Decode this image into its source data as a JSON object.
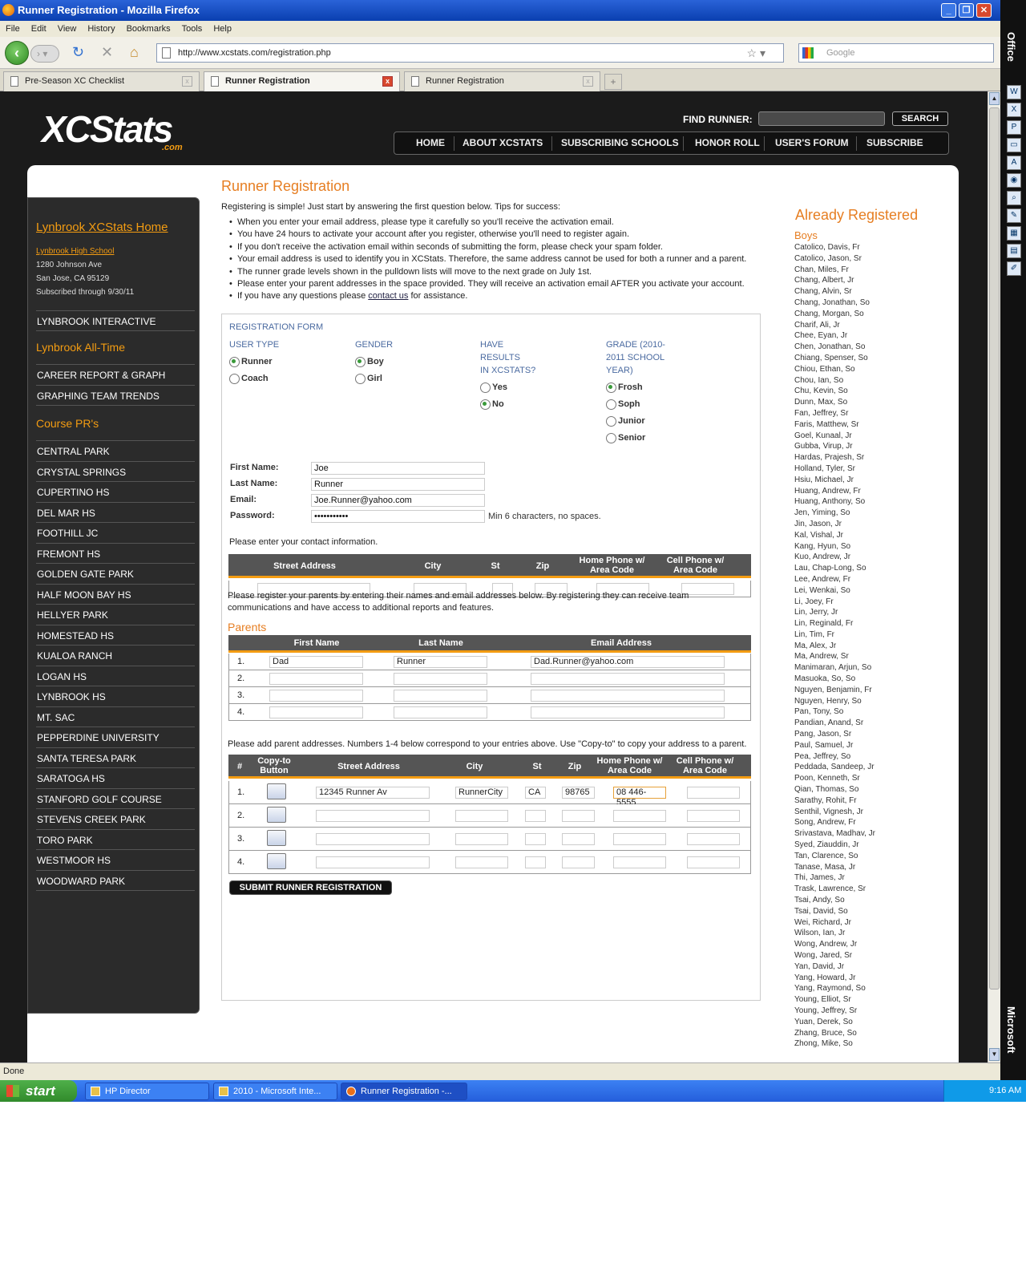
{
  "window": {
    "title": "Runner Registration - Mozilla Firefox"
  },
  "menu": [
    "File",
    "Edit",
    "View",
    "History",
    "Bookmarks",
    "Tools",
    "Help"
  ],
  "url": "http://www.xcstats.com/registration.php",
  "search_placeholder": "Google",
  "tabs": [
    {
      "label": "Pre-Season XC Checklist"
    },
    {
      "label": "Runner Registration"
    },
    {
      "label": "Runner Registration"
    }
  ],
  "status": "Done",
  "taskbar": {
    "start": "start",
    "items": [
      "HP Director",
      "2010 - Microsoft Inte...",
      "Runner Registration -..."
    ],
    "clock": "9:16 AM"
  },
  "officebar": {
    "top": "Office",
    "bottom": "Microsoft"
  },
  "site": {
    "logo": "XCStats",
    "logo_sub": ".com",
    "find_label": "FIND RUNNER:",
    "search_btn": "SEARCH",
    "nav": [
      "HOME",
      "ABOUT XCSTATS",
      "SUBSCRIBING SCHOOLS",
      "HONOR ROLL",
      "USER'S FORUM",
      "SUBSCRIBE"
    ]
  },
  "sidebar": {
    "home": "Lynbrook XCStats Home",
    "school": "Lynbrook High School",
    "addr1": "1280 Johnson Ave",
    "addr2": "San Jose, CA 95129",
    "sub": "Subscribed through 9/30/11",
    "interactive": "LYNBROOK INTERACTIVE",
    "alltime": "Lynbrook All-Time",
    "alltime_items": [
      "CAREER REPORT & GRAPH",
      "GRAPHING TEAM TRENDS"
    ],
    "course_head": "Course PR's",
    "courses": [
      "CENTRAL PARK",
      "CRYSTAL SPRINGS",
      "CUPERTINO HS",
      "DEL MAR HS",
      "FOOTHILL JC",
      "FREMONT HS",
      "GOLDEN GATE PARK",
      "HALF MOON BAY HS",
      "HELLYER PARK",
      "HOMESTEAD HS",
      "KUALOA RANCH",
      "LOGAN HS",
      "LYNBROOK HS",
      "MT. SAC",
      "PEPPERDINE UNIVERSITY",
      "SANTA TERESA PARK",
      "SARATOGA HS",
      "STANFORD GOLF COURSE",
      "STEVENS CREEK PARK",
      "TORO PARK",
      "WESTMOOR HS",
      "WOODWARD PARK"
    ]
  },
  "page": {
    "title": "Runner Registration",
    "intro": "Registering is simple! Just start by answering the first question below. Tips for success:",
    "tips_pre": [
      "When you enter your email address, please type it carefully so you'll receive the activation email.",
      "You have 24 hours to activate your account after you register, otherwise you'll need to register again.",
      "If you don't receive the activation email within seconds of submitting the form, please check your spam folder.",
      "Your email address is used to identify you in XCStats. Therefore, the same address cannot be used for both a runner and a parent.",
      "The runner grade levels shown in the pulldown lists will move to the next grade on July 1st.",
      "Please enter your parent addresses in the space provided. They will receive an activation email AFTER you activate your account."
    ],
    "tip_last_a": "If you have any questions please ",
    "tip_last_link": "contact us",
    "tip_last_b": " for assistance."
  },
  "form": {
    "heading": "REGISTRATION FORM",
    "user_type": {
      "label": "USER TYPE",
      "options": [
        "Runner",
        "Coach"
      ],
      "selected": "Runner"
    },
    "gender": {
      "label": "GENDER",
      "options": [
        "Boy",
        "Girl"
      ],
      "selected": "Boy"
    },
    "results": {
      "label1": "HAVE",
      "label2": "RESULTS",
      "label3": "IN XCSTATS?",
      "options": [
        "Yes",
        "No"
      ],
      "selected": "No"
    },
    "grade": {
      "label1": "GRADE (2010-",
      "label2": "2011 SCHOOL",
      "label3": "YEAR)",
      "options": [
        "Frosh",
        "Soph",
        "Junior",
        "Senior"
      ],
      "selected": "Frosh"
    },
    "first_name_label": "First Name:",
    "first_name": "Joe",
    "last_name_label": "Last Name:",
    "last_name": "Runner",
    "email_label": "Email:",
    "email": "Joe.Runner@yahoo.com",
    "password_label": "Password:",
    "password": "•••••••••••",
    "password_hint": "Min 6 characters, no spaces.",
    "contact_hint": "Please enter your contact information.",
    "contact_headers": [
      "Street Address",
      "City",
      "St",
      "Zip",
      "Home Phone w/ Area Code",
      "Cell Phone w/ Area Code"
    ],
    "parent_hint": "Please register your parents by entering their names and email addresses below. By registering they can receive team communications and have access to additional reports and features.",
    "parents_heading": "Parents",
    "parent_headers": [
      "First Name",
      "Last Name",
      "Email Address"
    ],
    "parents": [
      {
        "num": "1.",
        "first": "Dad",
        "last": "Runner",
        "email": "Dad.Runner@yahoo.com"
      },
      {
        "num": "2.",
        "first": "",
        "last": "",
        "email": ""
      },
      {
        "num": "3.",
        "first": "",
        "last": "",
        "email": ""
      },
      {
        "num": "4.",
        "first": "",
        "last": "",
        "email": ""
      }
    ],
    "addr_hint": "Please add parent addresses. Numbers 1-4 below correspond to your entries above. Use \"Copy-to\" to copy your address to a parent.",
    "addr_headers": [
      "#",
      "Copy-to Button",
      "Street Address",
      "City",
      "St",
      "Zip",
      "Home Phone w/ Area Code",
      "Cell Phone w/ Area Code"
    ],
    "addresses": [
      {
        "num": "1.",
        "street": "12345 Runner Av",
        "city": "RunnerCity",
        "st": "CA",
        "zip": "98765",
        "home": "08 446-5555",
        "cell": ""
      },
      {
        "num": "2.",
        "street": "",
        "city": "",
        "st": "",
        "zip": "",
        "home": "",
        "cell": ""
      },
      {
        "num": "3.",
        "street": "",
        "city": "",
        "st": "",
        "zip": "",
        "home": "",
        "cell": ""
      },
      {
        "num": "4.",
        "street": "",
        "city": "",
        "st": "",
        "zip": "",
        "home": "",
        "cell": ""
      }
    ],
    "submit": "SUBMIT RUNNER REGISTRATION"
  },
  "registered": {
    "title": "Already Registered",
    "sub": "Boys",
    "names": [
      "Catolico, Davis, Fr",
      "Catolico, Jason, Sr",
      "Chan, Miles, Fr",
      "Chang, Albert, Jr",
      "Chang, Alvin, Sr",
      "Chang, Jonathan, So",
      "Chang, Morgan, So",
      "Charif, Ali, Jr",
      "Chee, Eyan, Jr",
      "Chen, Jonathan, So",
      "Chiang, Spenser, So",
      "Chiou, Ethan, So",
      "Chou, Ian, So",
      "Chu, Kevin, So",
      "Dunn, Max, So",
      "Fan, Jeffrey, Sr",
      "Faris, Matthew, Sr",
      "Goel, Kunaal, Jr",
      "Gubba, Virup, Jr",
      "Hardas, Prajesh, Sr",
      "Holland, Tyler, Sr",
      "Hsiu, Michael, Jr",
      "Huang, Andrew, Fr",
      "Huang, Anthony, So",
      "Jen, Yiming, So",
      "Jin, Jason, Jr",
      "Kal, Vishal, Jr",
      "Kang, Hyun, So",
      "Kuo, Andrew, Jr",
      "Lau, Chap-Long, So",
      "Lee, Andrew, Fr",
      "Lei, Wenkai, So",
      "Li, Joey, Fr",
      "Lin, Jerry, Jr",
      "Lin, Reginald, Fr",
      "Lin, Tim, Fr",
      "Ma, Alex, Jr",
      "Ma, Andrew, Sr",
      "Manimaran, Arjun, So",
      "Masuoka, So, So",
      "Nguyen, Benjamin, Fr",
      "Nguyen, Henry, So",
      "Pan, Tony, So",
      "Pandian, Anand, Sr",
      "Pang, Jason, Sr",
      "Paul, Samuel, Jr",
      "Pea, Jeffrey, So",
      "Peddada, Sandeep, Jr",
      "Poon, Kenneth, Sr",
      "Qian, Thomas, So",
      "Sarathy, Rohit, Fr",
      "Senthil, Vignesh, Jr",
      "Song, Andrew, Fr",
      "Srivastava, Madhav, Jr",
      "Syed, Ziauddin, Jr",
      "Tan, Clarence, So",
      "Tanase, Masa, Jr",
      "Thi, James, Jr",
      "Trask, Lawrence, Sr",
      "Tsai, Andy, So",
      "Tsai, David, So",
      "Wei, Richard, Jr",
      "Wilson, Ian, Jr",
      "Wong, Andrew, Jr",
      "Wong, Jared, Sr",
      "Yan, David, Jr",
      "Yang, Howard, Jr",
      "Yang, Raymond, So",
      "Young, Elliot, Sr",
      "Young, Jeffrey, Sr",
      "Yuan, Derek, So",
      "Zhang, Bruce, So",
      "Zhong, Mike, So"
    ]
  }
}
